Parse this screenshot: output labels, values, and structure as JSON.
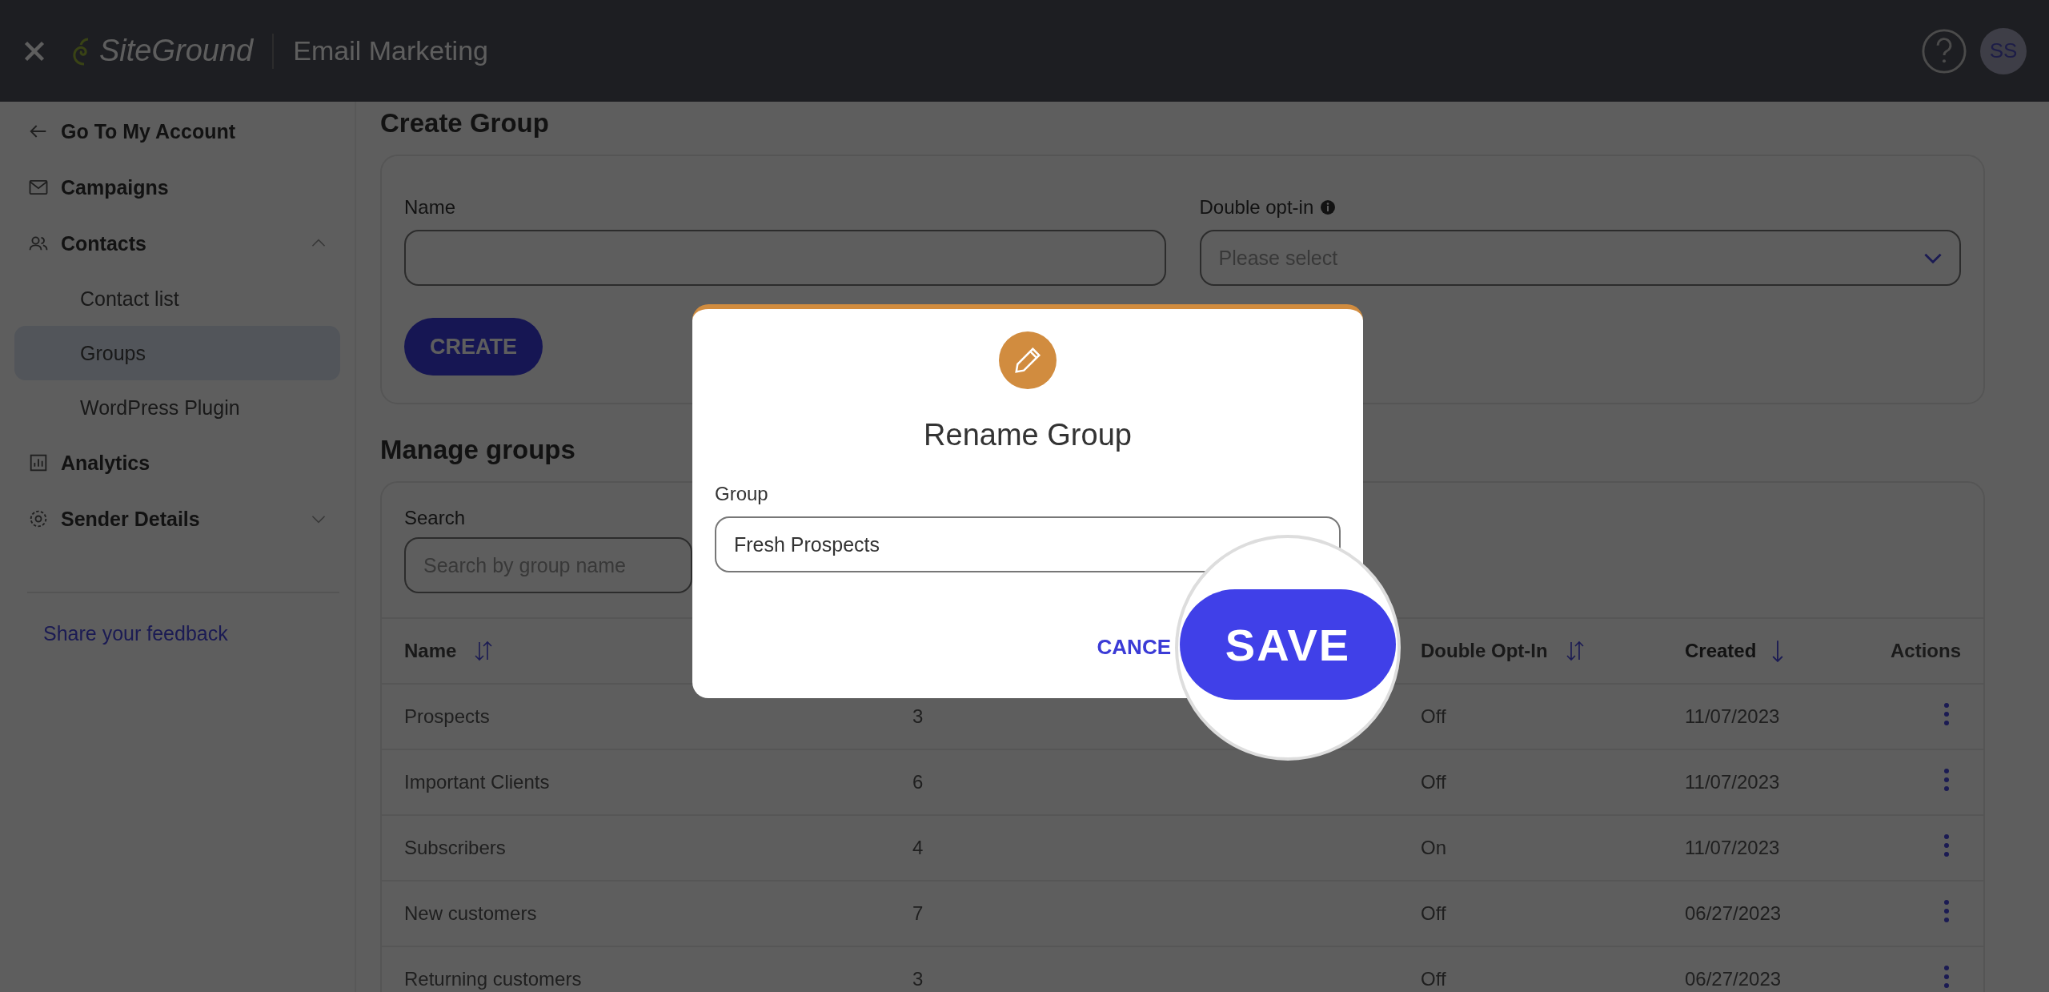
{
  "top_bar": {
    "brand": "SiteGround",
    "product": "Email Marketing",
    "avatar": "SS"
  },
  "sidebar": {
    "back_link": "Go To My Account",
    "items": [
      {
        "label": "Campaigns",
        "kind": "plain"
      },
      {
        "label": "Contacts",
        "kind": "group",
        "expanded": true,
        "children": [
          {
            "label": "Contact list",
            "selected": false
          },
          {
            "label": "Groups",
            "selected": true
          },
          {
            "label": "WordPress Plugin",
            "selected": false
          }
        ]
      },
      {
        "label": "Analytics",
        "kind": "plain"
      },
      {
        "label": "Sender Details",
        "kind": "group",
        "expanded": false
      }
    ],
    "feedback_link": "Share your feedback"
  },
  "create_group": {
    "title": "Create Group",
    "name_label": "Name",
    "optin_label": "Double opt-in",
    "optin_placeholder": "Please select",
    "button": "CREATE"
  },
  "manage_groups": {
    "title": "Manage groups",
    "search_label": "Search",
    "search_placeholder": "Search by group name",
    "columns": [
      {
        "label": "Name",
        "sortable": true,
        "sorted": false
      },
      {
        "label": "Double Opt-In",
        "sortable": true,
        "sorted": false
      },
      {
        "label": "Created",
        "sortable": true,
        "sorted": true
      },
      {
        "label": "Actions"
      }
    ],
    "rows": [
      {
        "name": "Prospects",
        "count": "3",
        "double_opt_in": "Off",
        "created": "11/07/2023"
      },
      {
        "name": "Important Clients",
        "count": "6",
        "double_opt_in": "Off",
        "created": "11/07/2023"
      },
      {
        "name": "Subscribers",
        "count": "4",
        "double_opt_in": "On",
        "created": "11/07/2023"
      },
      {
        "name": "New customers",
        "count": "7",
        "double_opt_in": "Off",
        "created": "06/27/2023"
      },
      {
        "name": "Returning customers",
        "count": "3",
        "double_opt_in": "Off",
        "created": "06/27/2023"
      }
    ]
  },
  "dialog": {
    "title": "Rename Group",
    "field_label": "Group",
    "value": "Fresh Prospects",
    "cancel": "CANCE",
    "save": "SAVE"
  }
}
